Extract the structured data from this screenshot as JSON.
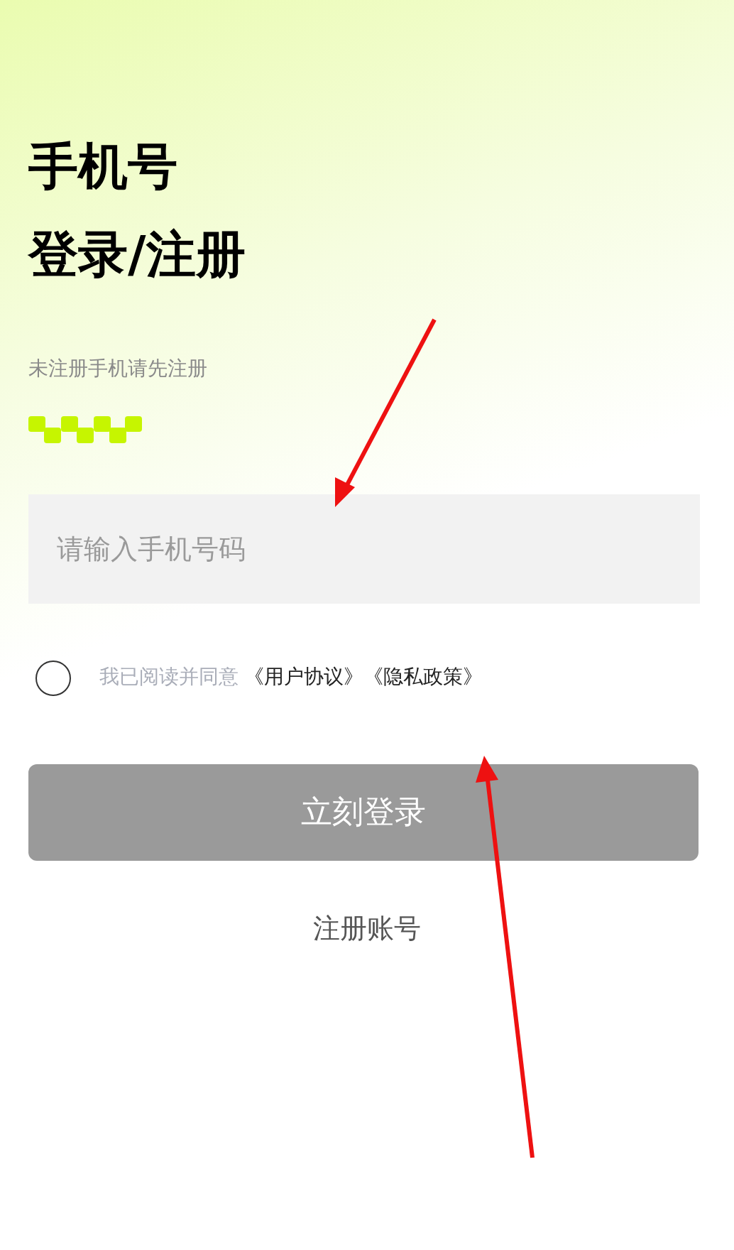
{
  "title_lines": [
    "手机号",
    "登录/注册"
  ],
  "subtitle": "未注册手机请先注册",
  "phone_field": {
    "placeholder": "请输入手机号码"
  },
  "agreement": {
    "checked": false,
    "text": "我已阅读并同意",
    "links": [
      "《用户协议》",
      "《隐私政策》"
    ]
  },
  "login_button": {
    "label": "立刻登录",
    "disabled": true
  },
  "register_link": "注册账号"
}
